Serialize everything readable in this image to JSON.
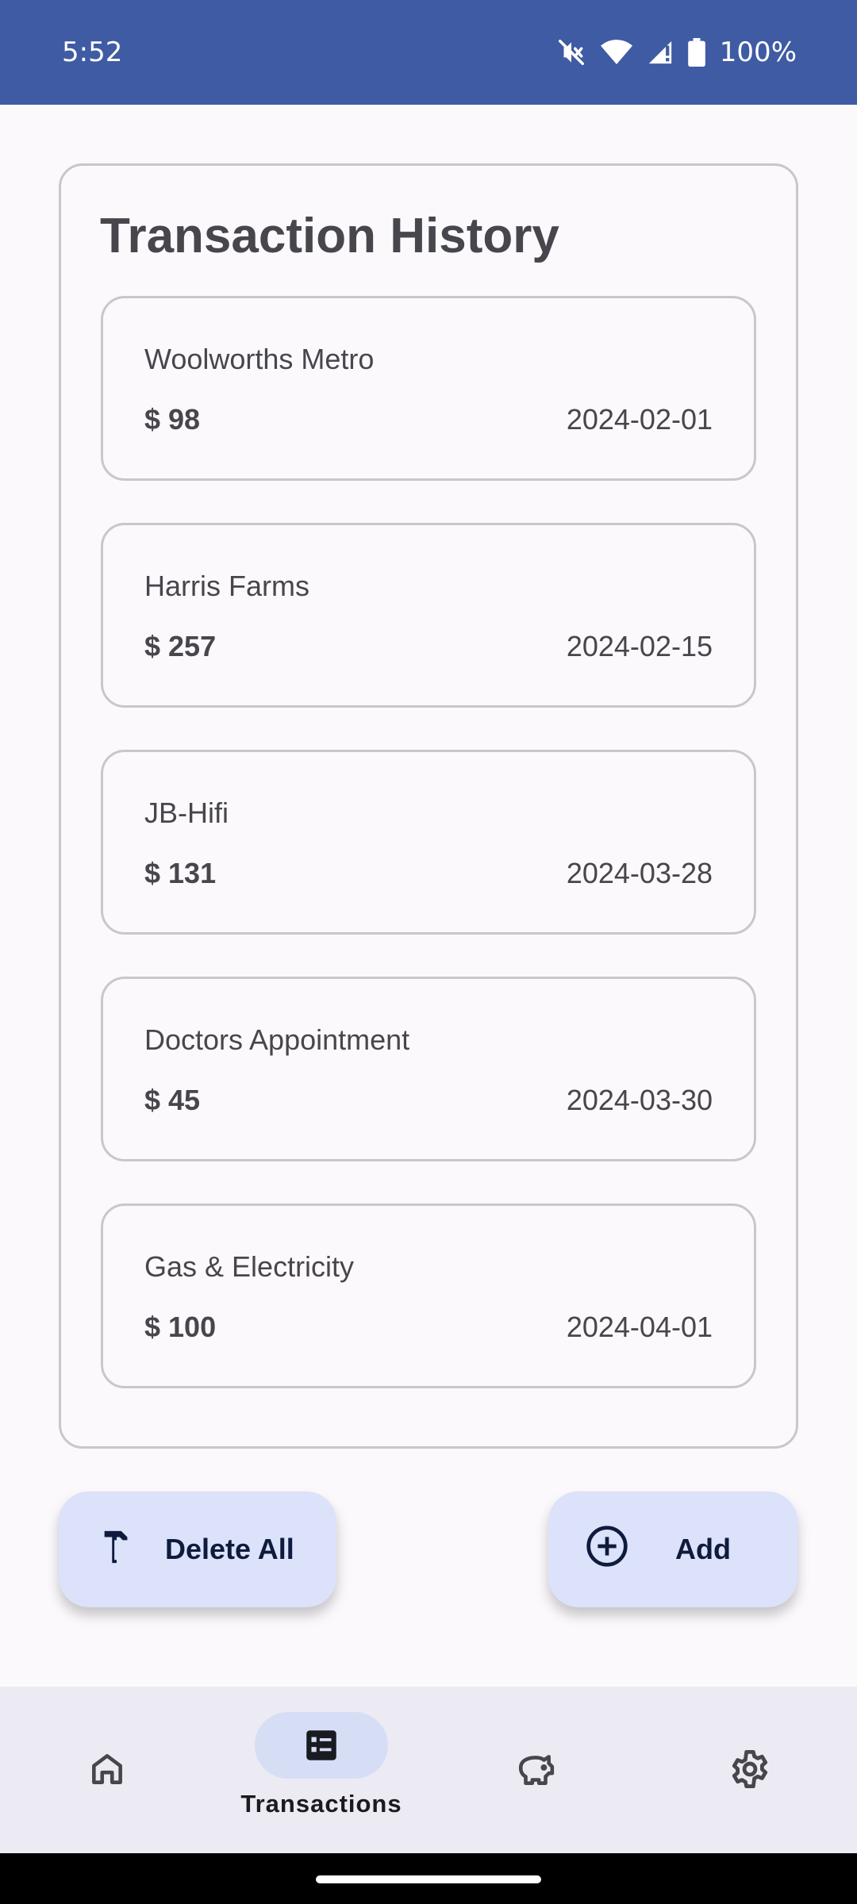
{
  "status_bar": {
    "time": "5:52",
    "battery": "100%",
    "icons": [
      "mute-icon",
      "wifi-icon",
      "signal-icon",
      "battery-icon"
    ]
  },
  "history": {
    "title": "Transaction History",
    "transactions": [
      {
        "name": "Woolworths Metro",
        "amount": "$ 98",
        "date": "2024-02-01"
      },
      {
        "name": "Harris Farms",
        "amount": "$ 257",
        "date": "2024-02-15"
      },
      {
        "name": "JB-Hifi",
        "amount": "$ 131",
        "date": "2024-03-28"
      },
      {
        "name": "Doctors Appointment",
        "amount": "$ 45",
        "date": "2024-03-30"
      },
      {
        "name": "Gas & Electricity",
        "amount": "$ 100",
        "date": "2024-04-01"
      }
    ]
  },
  "actions": {
    "delete_all_label": "Delete All",
    "delete_icon": "hammer-icon",
    "add_label": "Add",
    "add_icon": "add-circle-icon"
  },
  "bottom_nav": {
    "items": [
      {
        "id": "home",
        "icon": "home-icon",
        "label": ""
      },
      {
        "id": "transactions",
        "icon": "list-alt-icon",
        "label": "Transactions",
        "active": true
      },
      {
        "id": "savings",
        "icon": "piggy-bank-icon",
        "label": ""
      },
      {
        "id": "settings",
        "icon": "gear-icon",
        "label": ""
      }
    ]
  },
  "colors": {
    "status_bar": "#3f5ba3",
    "button_bg": "#dbe2f9",
    "nav_bg": "#eceaf3",
    "nav_active_pill": "#d6def6",
    "text": "#47464c"
  }
}
